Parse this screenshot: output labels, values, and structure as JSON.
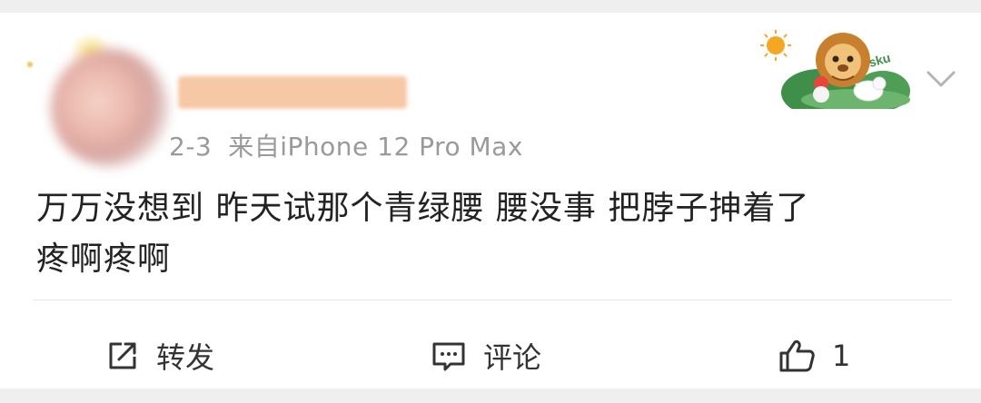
{
  "post": {
    "meta": {
      "time": "2-3",
      "source": "来自iPhone 12 Pro Max"
    },
    "content_line1": "万万没想到  昨天试那个青绿腰  腰没事  把脖子抻着了",
    "content_line2": "疼啊疼啊"
  },
  "actions": {
    "share_label": "转发",
    "comment_label": "评论",
    "like_count": "1"
  },
  "icons": {
    "share": "share-icon",
    "comment": "comment-icon",
    "like": "thumbs-up-icon",
    "more": "chevron-down-icon"
  }
}
